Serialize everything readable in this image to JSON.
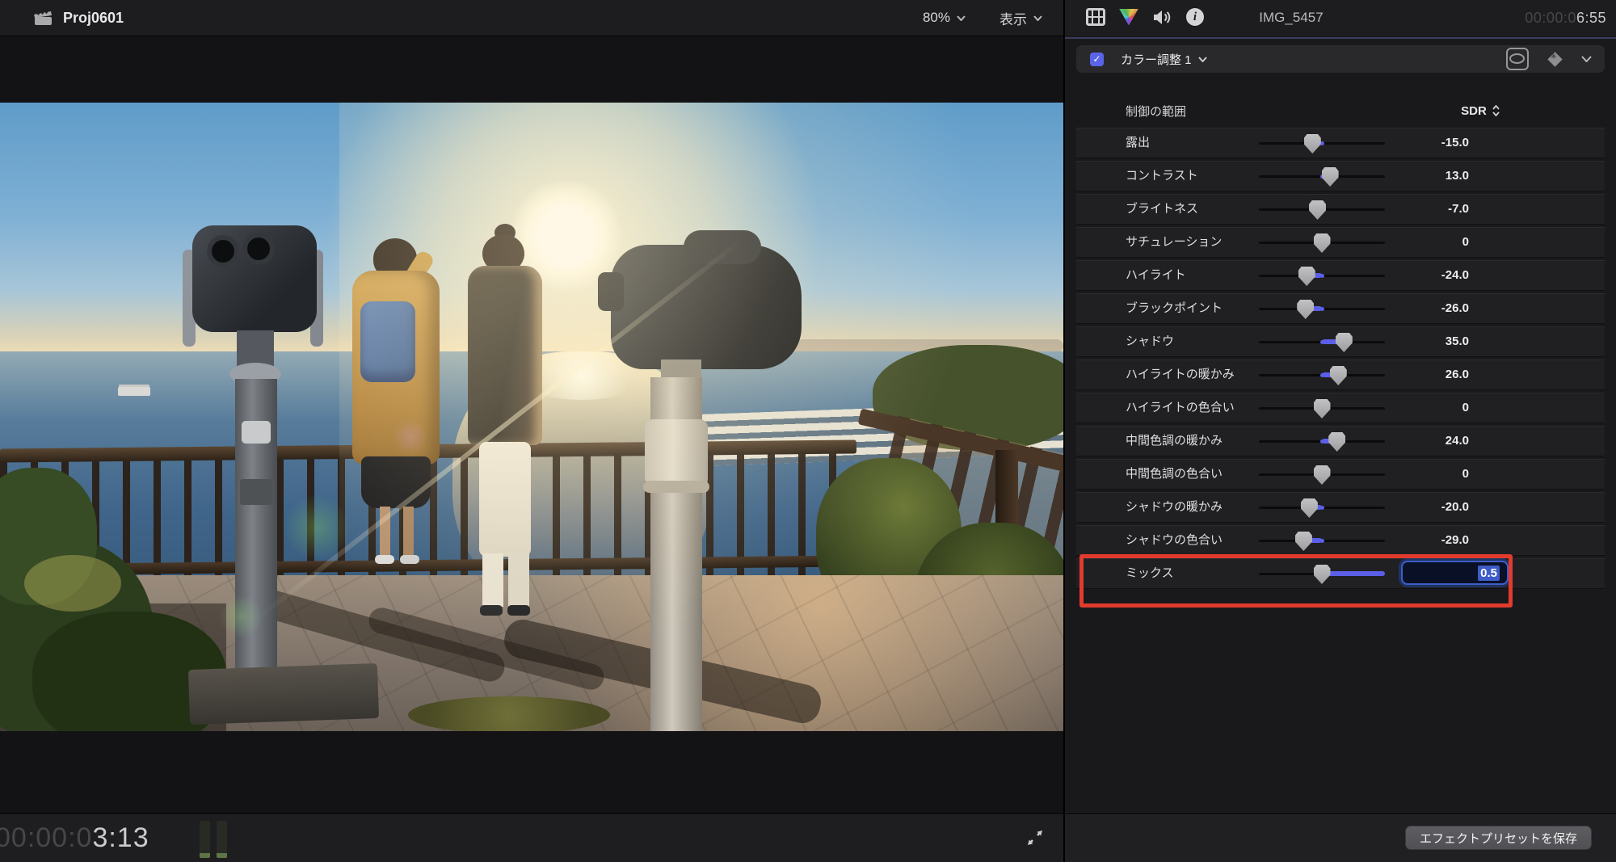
{
  "viewer": {
    "topbar": {
      "project_title": "Proj0601",
      "zoom_label": "80%",
      "view_menu_label": "表示",
      "icons": [
        "clapperboard-icon",
        "chevron-down-icon",
        "chevron-down-icon"
      ]
    },
    "bottombar": {
      "timecode_dim": "00:00:0",
      "timecode_bright": "3:13",
      "icons": [
        "audio-meters-icon",
        "expand-icon"
      ]
    }
  },
  "inspector": {
    "topbar": {
      "clip_title": "IMG_5457",
      "timecode_dim": "00:00:0",
      "timecode_bright": "6:55",
      "icons": [
        "filmstrip-icon",
        "color-triangle-icon",
        "speaker-icon",
        "info-icon"
      ]
    },
    "effect_header": {
      "name": "カラー調整 1",
      "enabled": true,
      "icons": [
        "checkbox",
        "chevron-down-icon",
        "mask-icon",
        "keyframe-diamond-icon",
        "chevron-down-icon"
      ]
    },
    "control_range": {
      "label": "制御の範囲",
      "value": "SDR"
    },
    "params": [
      {
        "id": "exposure",
        "label": "露出",
        "display": "-15.0",
        "value": -15,
        "min": -100,
        "max": 100,
        "default": 0
      },
      {
        "id": "contrast",
        "label": "コントラスト",
        "display": "13.0",
        "value": 13,
        "min": -100,
        "max": 100,
        "default": 0
      },
      {
        "id": "brightness",
        "label": "ブライトネス",
        "display": "-7.0",
        "value": -7,
        "min": -100,
        "max": 100,
        "default": 0
      },
      {
        "id": "saturation",
        "label": "サチュレーション",
        "display": "0",
        "value": 0,
        "min": -100,
        "max": 100,
        "default": 0
      },
      {
        "id": "highlights",
        "label": "ハイライト",
        "display": "-24.0",
        "value": -24,
        "min": -100,
        "max": 100,
        "default": 0
      },
      {
        "id": "black-point",
        "label": "ブラックポイント",
        "display": "-26.0",
        "value": -26,
        "min": -100,
        "max": 100,
        "default": 0
      },
      {
        "id": "shadows",
        "label": "シャドウ",
        "display": "35.0",
        "value": 35,
        "min": -100,
        "max": 100,
        "default": 0
      },
      {
        "id": "highlight-warmth",
        "label": "ハイライトの暖かみ",
        "display": "26.0",
        "value": 26,
        "min": -100,
        "max": 100,
        "default": 0
      },
      {
        "id": "highlight-tint",
        "label": "ハイライトの色合い",
        "display": "0",
        "value": 0,
        "min": -100,
        "max": 100,
        "default": 0
      },
      {
        "id": "midtone-warmth",
        "label": "中間色調の暖かみ",
        "display": "24.0",
        "value": 24,
        "min": -100,
        "max": 100,
        "default": 0
      },
      {
        "id": "midtone-tint",
        "label": "中間色調の色合い",
        "display": "0",
        "value": 0,
        "min": -100,
        "max": 100,
        "default": 0
      },
      {
        "id": "shadow-warmth",
        "label": "シャドウの暖かみ",
        "display": "-20.0",
        "value": -20,
        "min": -100,
        "max": 100,
        "default": 0
      },
      {
        "id": "shadow-tint",
        "label": "シャドウの色合い",
        "display": "-29.0",
        "value": -29,
        "min": -100,
        "max": 100,
        "default": 0
      },
      {
        "id": "mix",
        "label": "ミックス",
        "display": "0.5",
        "value": 0.5,
        "min": 0,
        "max": 1,
        "default": 1,
        "field": true,
        "highlighted": true
      }
    ],
    "save_button_label": "エフェクトプリセットを保存"
  },
  "annotation": {
    "type": "highlight-rectangle",
    "color": "#e23b2e",
    "target": "mix"
  },
  "colors": {
    "accent_blue": "#5b5fe8",
    "checkbox_blue": "#5a64e8",
    "field_focus_ring": "#3e5ec8",
    "selection_blue": "#3d5cc8"
  }
}
